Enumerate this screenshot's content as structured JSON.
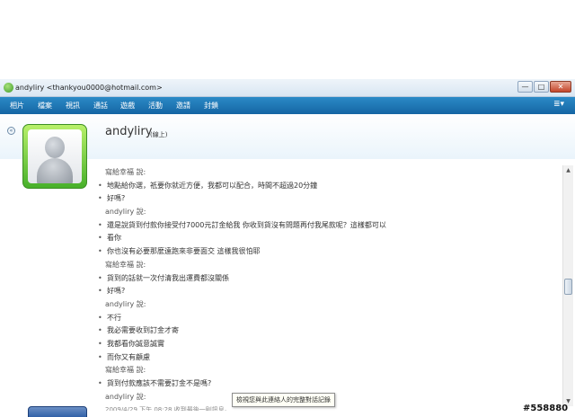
{
  "window": {
    "title": "andyliry <thankyou0000@hotmail.com>",
    "controls": {
      "minimize": "—",
      "maximize": "□",
      "close": "✕"
    }
  },
  "menu": {
    "items": [
      "相片",
      "檔案",
      "視訊",
      "通話",
      "遊戲",
      "活動",
      "邀請",
      "封鎖"
    ],
    "right_icon": "menu-options-icon",
    "right_glyph": "≣▾"
  },
  "contact": {
    "name": "andyliry",
    "status": "(線上)"
  },
  "conversation": [
    {
      "type": "sender",
      "text": "寫給幸福 說:"
    },
    {
      "type": "msg",
      "text": "地點給你選，祇要你就近方便，我都可以配合，時間不超過20分鐘"
    },
    {
      "type": "msg",
      "text": "好嗎?"
    },
    {
      "type": "sender",
      "text": "andyliry 說:"
    },
    {
      "type": "msg",
      "text": "還是說貨到付款你接受付7000元訂金給我 你收到貨沒有問題再付我尾款呢？這樣都可以"
    },
    {
      "type": "msg",
      "text": "看你"
    },
    {
      "type": "msg",
      "text": "你也沒有必要那麼遠跑來非要面交  這樣我很怕耶"
    },
    {
      "type": "sender",
      "text": "寫給幸福 說:"
    },
    {
      "type": "msg",
      "text": "貨到的話就一次付清我出運費都沒關係"
    },
    {
      "type": "msg",
      "text": "好嗎?"
    },
    {
      "type": "sender",
      "text": "andyliry 說:"
    },
    {
      "type": "msg",
      "text": "不行"
    },
    {
      "type": "msg",
      "text": "我必需要收到訂金才寄"
    },
    {
      "type": "msg",
      "text": "我都看你誠意誠實"
    },
    {
      "type": "msg",
      "text": "而你又有顧慮"
    },
    {
      "type": "sender",
      "text": "寫給幸福 說:"
    },
    {
      "type": "msg",
      "text": "貨到付款應該不需要訂金不是嗎?"
    },
    {
      "type": "sender",
      "text": "andyliry 說:"
    },
    {
      "type": "timestamp",
      "text": "2009/4/29 下午 08:28 收到最後一則訊息。"
    }
  ],
  "tooltip": {
    "text": "檢視您與此連絡人的完整對話記錄"
  },
  "watermark": {
    "text": "#558880"
  },
  "icons": {
    "collapse": "collapse-circle-icon",
    "scroll_up": "scroll-up-arrow-icon",
    "scroll_down": "scroll-down-arrow-icon"
  }
}
